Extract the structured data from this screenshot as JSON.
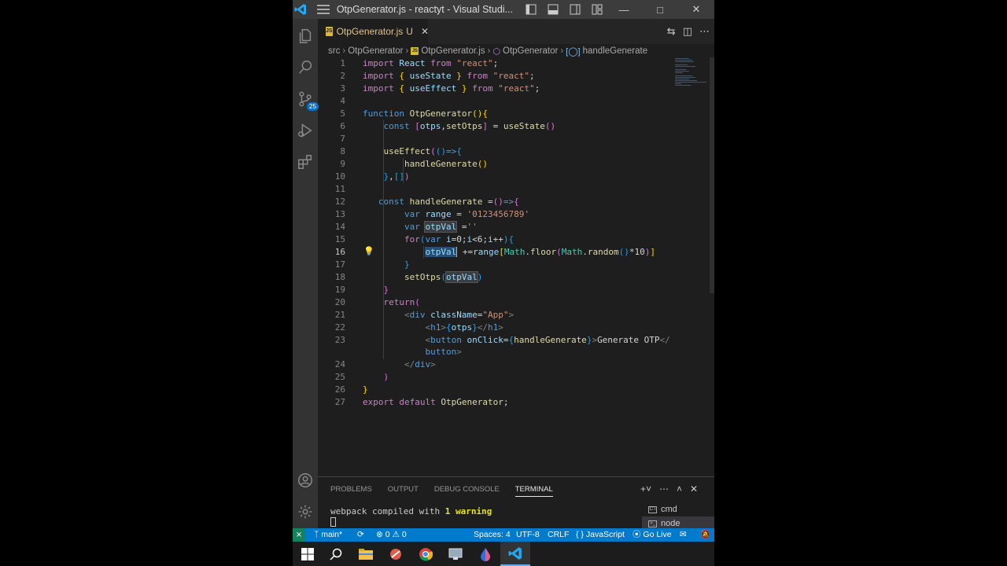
{
  "window": {
    "title": "OtpGenerator.js - reactyt - Visual Studi...",
    "activity_badge": "25"
  },
  "tab": {
    "filename": "OtpGenerator.js",
    "status": "U",
    "lang_badge": "JS"
  },
  "breadcrumbs": [
    "src",
    "OtpGenerator",
    "OtpGenerator.js",
    "OtpGenerator",
    "handleGenerate"
  ],
  "editor": {
    "line_numbers": [
      "1",
      "2",
      "3",
      "4",
      "5",
      "6",
      "7",
      "8",
      "9",
      "10",
      "11",
      "12",
      "13",
      "14",
      "15",
      "16",
      "17",
      "18",
      "19",
      "20",
      "21",
      "22",
      "23",
      "",
      "24",
      "25",
      "26",
      "27"
    ],
    "current_line": "16"
  },
  "panel": {
    "tabs": [
      "PROBLEMS",
      "OUTPUT",
      "DEBUG CONSOLE",
      "TERMINAL"
    ],
    "active_tab": "TERMINAL",
    "terminal_prefix": "webpack compiled with ",
    "terminal_warning": "1 warning",
    "terminals": [
      "cmd",
      "node"
    ]
  },
  "statusbar": {
    "branch": "main*",
    "problems": "0",
    "warnings": "0",
    "spaces": "Spaces: 4",
    "encoding": "UTF-8",
    "eol": "CRLF",
    "language": "JavaScript",
    "golive": "Go Live"
  },
  "colors": {
    "statusbar": "#007acc",
    "editor_bg": "#1e1e1e",
    "activitybar": "#333333",
    "titlebar": "#3c3c3c"
  },
  "icons": [
    "vscode-logo-icon",
    "menu-icon",
    "layout-sidebar-icon",
    "layout-panel-icon",
    "layout-secondary-icon",
    "layout-custom-icon",
    "minimize-icon",
    "maximize-icon",
    "close-icon",
    "explorer-icon",
    "search-icon",
    "source-control-icon",
    "run-debug-icon",
    "extensions-icon",
    "account-icon",
    "settings-icon",
    "lightbulb-icon",
    "windows-start-icon",
    "chrome-icon",
    "vscode-icon"
  ]
}
